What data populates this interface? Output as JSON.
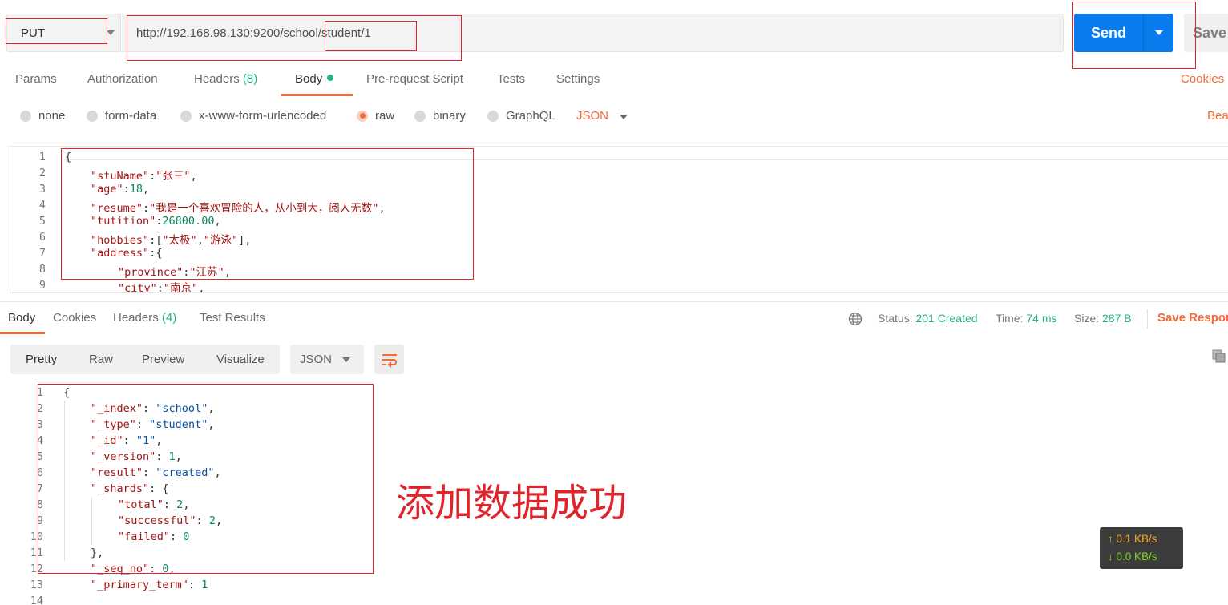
{
  "request": {
    "method": "PUT",
    "url": "http://192.168.98.130:9200/school/student/1",
    "send_label": "Send",
    "save_label": "Save"
  },
  "request_tabs": {
    "params": "Params",
    "authorization": "Authorization",
    "headers": "Headers",
    "headers_count": "(8)",
    "body": "Body",
    "prerequest": "Pre-request Script",
    "tests": "Tests",
    "settings": "Settings",
    "cookies": "Cookies"
  },
  "body_types": {
    "none": "none",
    "form_data": "form-data",
    "urlencoded": "x-www-form-urlencoded",
    "raw": "raw",
    "binary": "binary",
    "graphql": "GraphQL",
    "json": "JSON",
    "beautify": "Bea"
  },
  "request_body": {
    "line_numbers": [
      "1",
      "2",
      "3",
      "4",
      "5",
      "6",
      "7",
      "8",
      "9"
    ],
    "l1": "{",
    "stuName_key": "\"stuName\"",
    "stuName_val": "\"张三\"",
    "age_key": "\"age\"",
    "age_val": "18",
    "resume_key": "\"resume\"",
    "resume_val": "\"我是一个喜欢冒险的人，从小到大，阅人无数\"",
    "tuition_key": "\"tutition\"",
    "tuition_val": "26800.00",
    "hobbies_key": "\"hobbies\"",
    "hobby1": "\"太极\"",
    "hobby2": "\"游泳\"",
    "address_key": "\"address\"",
    "province_key": "\"province\"",
    "province_val": "\"江苏\"",
    "city_key": "\"city\"",
    "city_val": "\"南京\""
  },
  "response_tabs": {
    "body": "Body",
    "cookies": "Cookies",
    "headers": "Headers",
    "headers_count": "(4)",
    "test_results": "Test Results"
  },
  "status": {
    "status_label": "Status:",
    "status_val": "201 Created",
    "time_label": "Time:",
    "time_val": "74 ms",
    "size_label": "Size:",
    "size_val": "287 B",
    "save_response": "Save Respor"
  },
  "view_modes": {
    "pretty": "Pretty",
    "raw": "Raw",
    "preview": "Preview",
    "visualize": "Visualize",
    "format": "JSON"
  },
  "response_body": {
    "line_numbers": [
      "1",
      "2",
      "3",
      "4",
      "5",
      "6",
      "7",
      "8",
      "9",
      "10",
      "11",
      "12",
      "13",
      "14"
    ],
    "l1": "{",
    "index_key": "\"_index\"",
    "index_val": "\"school\"",
    "type_key": "\"_type\"",
    "type_val": "\"student\"",
    "id_key": "\"_id\"",
    "id_val": "\"1\"",
    "version_key": "\"_version\"",
    "version_val": "1",
    "result_key": "\"result\"",
    "result_val": "\"created\"",
    "shards_key": "\"_shards\"",
    "total_key": "\"total\"",
    "total_val": "2",
    "successful_key": "\"successful\"",
    "successful_val": "2",
    "failed_key": "\"failed\"",
    "failed_val": "0",
    "close_shards": "},",
    "seq_key": "\"_seq_no\"",
    "seq_val": "0",
    "primary_key": "\"_primary_term\"",
    "primary_val": "1"
  },
  "annotation": "添加数据成功",
  "network": {
    "up": "↑ 0.1 KB/s",
    "down": "↓ 0.0 KB/s"
  },
  "colors": {
    "accent": "#f26b3a",
    "send_blue": "#097bed",
    "success_green": "#26b47f",
    "annotation_red": "#e0242c"
  }
}
